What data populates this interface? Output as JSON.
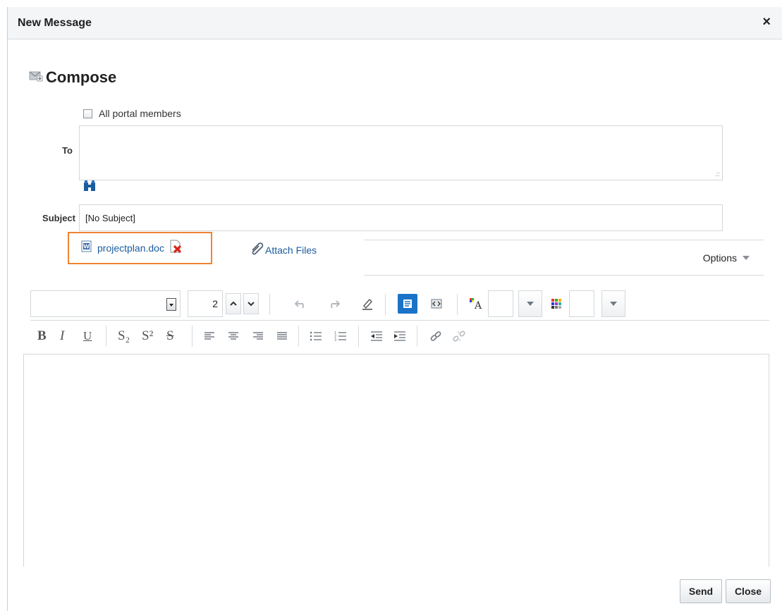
{
  "dialog": {
    "title": "New Message",
    "close_symbol": "×"
  },
  "compose": {
    "icon": "compose-envelope-icon",
    "title": "Compose"
  },
  "recipients": {
    "all_members_label": "All portal members",
    "all_members_checked": false,
    "to_label": "To",
    "to_value": "",
    "search_icon": "binoculars-icon"
  },
  "subject": {
    "label": "Subject",
    "value": "[No Subject]"
  },
  "attachments": {
    "file_name": "projectplan.doc",
    "file_icon": "word-doc-icon",
    "remove_icon": "delete-file-icon",
    "attach_label": "Attach Files",
    "attach_icon": "paperclip-icon"
  },
  "options": {
    "label": "Options"
  },
  "toolbar": {
    "font_name": "",
    "font_size": "2",
    "text_color": "",
    "background_color": "",
    "icons_row1": [
      "font-dropdown-icon",
      "size-up-icon",
      "size-down-icon",
      "undo-icon",
      "redo-icon",
      "clear-format-icon",
      "rich-text-mode-icon",
      "source-mode-icon",
      "text-color-icon",
      "background-color-icon"
    ],
    "bold": "B",
    "italic": "I",
    "underline": "U",
    "subscript": "S₂",
    "superscript": "S²",
    "strike": "S",
    "icons_row2": [
      "align-left-icon",
      "align-center-icon",
      "align-right-icon",
      "justify-icon",
      "bullet-list-icon",
      "numbered-list-icon",
      "outdent-icon",
      "indent-icon",
      "link-icon",
      "unlink-icon"
    ]
  },
  "body": {
    "value": ""
  },
  "buttons": {
    "send": "Send",
    "close": "Close"
  },
  "colors": {
    "highlight_border": "#f08330",
    "link": "#1a5c9e",
    "active_mode": "#1a73c8"
  }
}
